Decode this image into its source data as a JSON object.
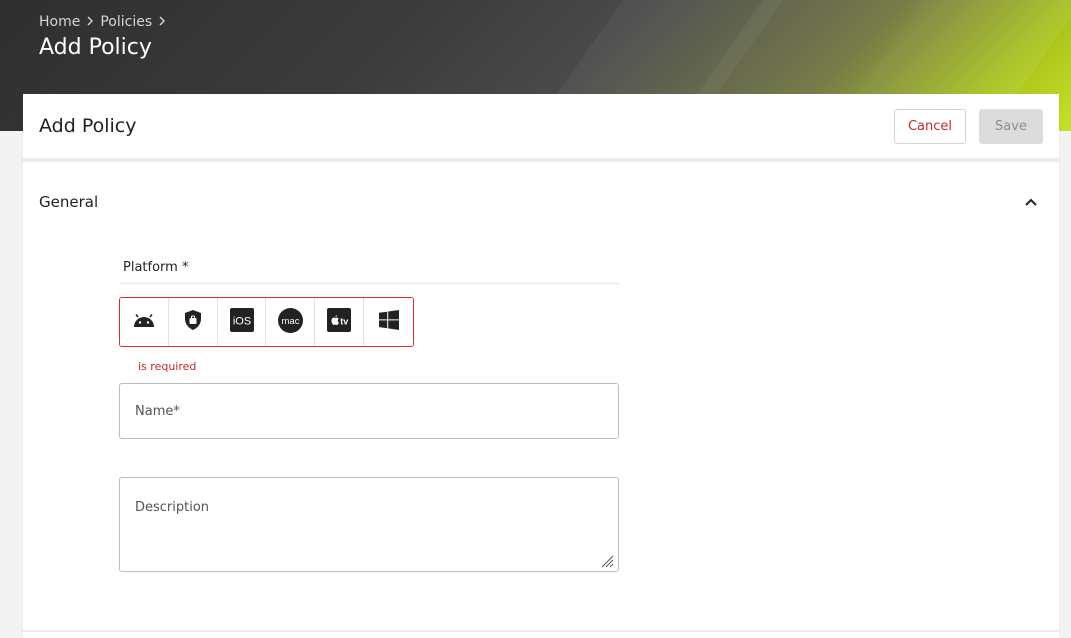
{
  "breadcrumb": {
    "items": [
      "Home",
      "Policies"
    ]
  },
  "header": {
    "title": "Add Policy"
  },
  "card": {
    "title": "Add Policy",
    "cancel_label": "Cancel",
    "save_label": "Save"
  },
  "section": {
    "title": "General"
  },
  "platform": {
    "label": "Platform *",
    "options": [
      "android-icon",
      "android-enterprise-icon",
      "ios-icon",
      "macos-icon",
      "appletv-icon",
      "windows-icon"
    ],
    "error": "is required"
  },
  "fields": {
    "name_placeholder": "Name*",
    "description_placeholder": "Description"
  },
  "colors": {
    "accent": "#a8c21a",
    "error": "#c62828"
  }
}
